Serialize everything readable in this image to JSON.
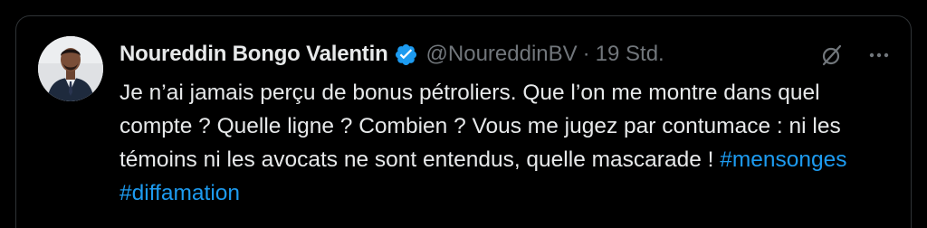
{
  "tweet": {
    "author": {
      "display_name": "Noureddin Bongo Valentin",
      "handle": "@NoureddinBV",
      "verified": true,
      "avatar_icon": "profile-photo"
    },
    "separator": "·",
    "timestamp": "19 Std.",
    "body": "Je n’ai jamais perçu de bonus pétroliers. Que l’on me montre dans quel compte ? Quelle ligne ? Combien ? Vous me jugez par contumace : ni les témoins ni les avocats ne sont entendus, quelle mascarade !",
    "hashtags": [
      "#mensonges",
      "#diffamation"
    ],
    "actions": {
      "grok_icon": "grok-icon",
      "more_icon": "more-options-icon"
    }
  },
  "colors": {
    "background": "#000000",
    "text_primary": "#e7e9ea",
    "text_secondary": "#71767b",
    "accent": "#1d9bf0",
    "border": "#2f3336"
  }
}
